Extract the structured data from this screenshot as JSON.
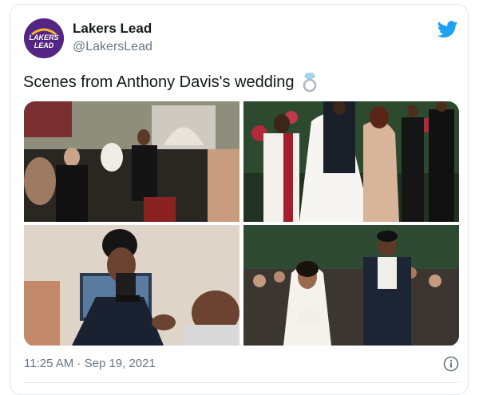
{
  "account": {
    "display_name": "Lakers Lead",
    "handle": "@LakersLead",
    "avatar_text_line1": "LAKERS",
    "avatar_text_line2": "LEAD"
  },
  "tweet": {
    "text": "Scenes from Anthony Davis's wedding",
    "emoji": "ring-icon"
  },
  "media": [
    {
      "name": "photo-wedding-ceremony-crowd"
    },
    {
      "name": "photo-bride-groom-officiant"
    },
    {
      "name": "photo-groom-adjusting-bowtie"
    },
    {
      "name": "photo-bride-groom-walking"
    }
  ],
  "footer": {
    "timestamp": "11:25 AM · Sep 19, 2021"
  },
  "colors": {
    "twitter_blue": "#1da1f2",
    "lakers_purple": "#552583",
    "lakers_gold": "#fdb927",
    "text_primary": "#14171a",
    "text_secondary": "#657786"
  }
}
